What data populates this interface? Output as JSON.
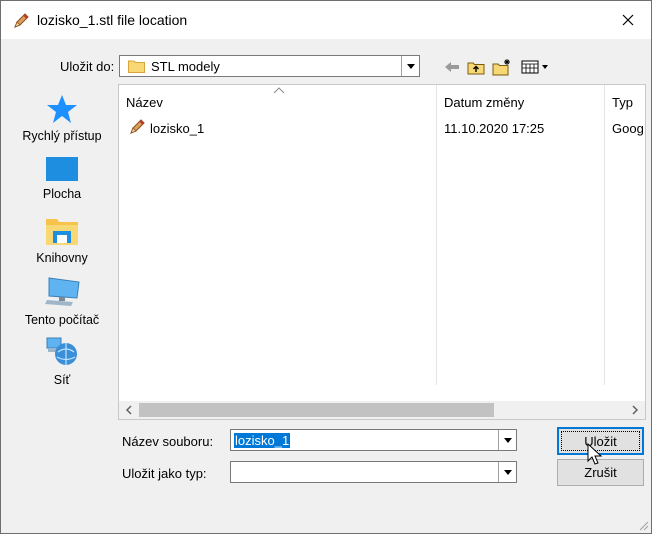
{
  "window": {
    "title": "lozisko_1.stl file location"
  },
  "toolbar": {
    "save_in_label": "Uložit do:",
    "save_in_value": "STL modely",
    "icons": [
      "back-arrow-icon",
      "up-folder-icon",
      "new-folder-icon",
      "view-menu-icon"
    ]
  },
  "places": [
    {
      "label": "Rychlý přístup",
      "icon": "star-icon"
    },
    {
      "label": "Plocha",
      "icon": "desktop-icon"
    },
    {
      "label": "Knihovny",
      "icon": "library-icon"
    },
    {
      "label": "Tento počítač",
      "icon": "computer-icon"
    },
    {
      "label": "Síť",
      "icon": "network-icon"
    }
  ],
  "filelist": {
    "columns": [
      "Název",
      "Datum změny",
      "Typ"
    ],
    "rows": [
      {
        "name": "lozisko_1",
        "date": "11.10.2020 17:25",
        "type": "Goog"
      }
    ]
  },
  "form": {
    "filename_label": "Název souboru:",
    "filename_value": "lozisko_1",
    "filetype_label": "Uložit jako typ:",
    "filetype_value": ""
  },
  "buttons": {
    "save": "Uložit",
    "cancel": "Zrušit"
  },
  "colors": {
    "selection": "#0078d7",
    "folder": "#f8d775",
    "accent": "#1e90ff"
  }
}
